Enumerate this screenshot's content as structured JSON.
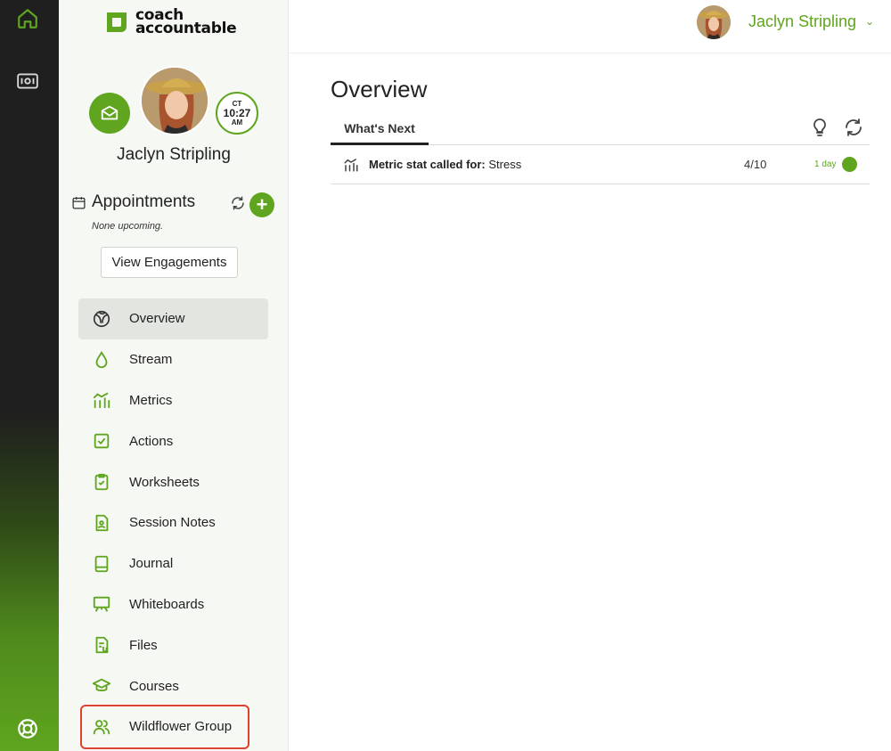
{
  "app": {
    "logo_line1": "coach",
    "logo_line2": "accountable"
  },
  "rail": {
    "home_icon": "home-icon",
    "dashboard_icon": "ticket-icon",
    "help_icon": "lifebuoy-icon"
  },
  "profile": {
    "name": "Jaclyn Stripling",
    "timezone": "CT",
    "time": "10:27",
    "ampm": "AM"
  },
  "appointments": {
    "title": "Appointments",
    "subtitle": "None upcoming.",
    "add_label": "+",
    "view_engagements": "View Engagements"
  },
  "nav": {
    "items": [
      {
        "label": "Overview",
        "icon": "overview-icon"
      },
      {
        "label": "Stream",
        "icon": "drop-icon"
      },
      {
        "label": "Metrics",
        "icon": "metrics-icon"
      },
      {
        "label": "Actions",
        "icon": "checkbox-icon"
      },
      {
        "label": "Worksheets",
        "icon": "clipboard-icon"
      },
      {
        "label": "Session Notes",
        "icon": "notes-icon"
      },
      {
        "label": "Journal",
        "icon": "journal-icon"
      },
      {
        "label": "Whiteboards",
        "icon": "whiteboard-icon"
      },
      {
        "label": "Files",
        "icon": "files-icon"
      },
      {
        "label": "Courses",
        "icon": "graduation-cap-icon"
      },
      {
        "label": "Wildflower Group",
        "icon": "group-icon"
      }
    ]
  },
  "header": {
    "user_name": "Jaclyn Stripling",
    "caret": "⌄"
  },
  "main": {
    "title": "Overview",
    "tab": "What's Next",
    "row": {
      "label_bold": "Metric stat called for:",
      "label_rest": " Stress",
      "value": "4/10",
      "due": "1 day"
    }
  },
  "colors": {
    "accent": "#5fa51f",
    "highlight": "#e0412e"
  }
}
